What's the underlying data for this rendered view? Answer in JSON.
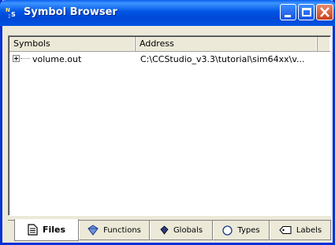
{
  "window": {
    "title": "Symbol Browser",
    "icon": "symbol-browser-icon"
  },
  "controls": {
    "minimize": "minimize-icon",
    "maximize": "maximize-icon",
    "close": "close-icon"
  },
  "table": {
    "columns": [
      "Symbols",
      "Address"
    ],
    "rows": [
      {
        "symbol": "volume.out",
        "address": "C:\\CCStudio_v3.3\\tutorial\\sim64xx\\v..."
      }
    ]
  },
  "tabs": [
    {
      "label": "Files",
      "icon": "document-icon",
      "active": true
    },
    {
      "label": "Functions",
      "icon": "function-icon",
      "active": false
    },
    {
      "label": "Globals",
      "icon": "globe-icon",
      "active": false
    },
    {
      "label": "Types",
      "icon": "circle-icon",
      "active": false
    },
    {
      "label": "Labels",
      "icon": "label-icon",
      "active": false
    }
  ],
  "colors": {
    "titlebar": "#0054e3",
    "close_button": "#c8411d",
    "face": "#ece9d8"
  }
}
